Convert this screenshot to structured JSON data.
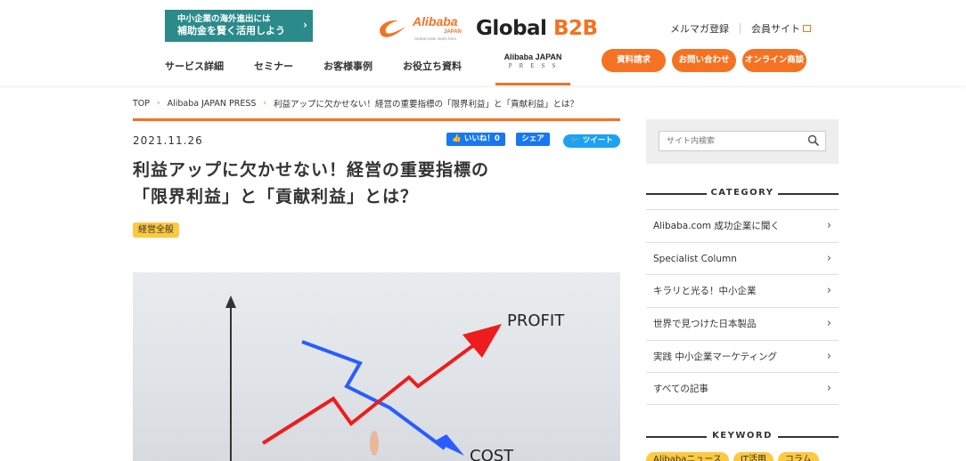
{
  "header": {
    "promo_line1": "中小企業の海外進出には",
    "promo_line2": "補助金を賢く活用しよう",
    "logo_alibaba": "Alibaba",
    "logo_japan": "JAPAN",
    "logo_tagline": "Global trade starts here.",
    "logo_global": "Global",
    "logo_b2b": "B2B",
    "top_links": [
      "メルマガ登録",
      "会員サイト"
    ],
    "nav": [
      "サービス詳細",
      "セミナー",
      "お客様事例",
      "お役立ち資料"
    ],
    "press_line1": "Alibaba JAPAN",
    "press_line2": "PRESS",
    "buttons": [
      "資料請求",
      "お問い合わせ",
      "オンライン商談"
    ]
  },
  "breadcrumb": [
    "TOP",
    "Alibaba JAPAN PRESS",
    "利益アップに欠かせない！経営の重要指標の「限界利益」と「貢献利益」とは？"
  ],
  "article": {
    "date": "2021.11.26",
    "fb_like": "いいね！0",
    "fb_share": "シェア",
    "tweet": "ツイート",
    "title_line1": "利益アップに欠かせない！経営の重要指標の",
    "title_line2": "「限界利益」と「貢献利益」とは？",
    "tag": "経営全般",
    "image_text_profit": "PROFIT",
    "image_text_cost": "COST"
  },
  "sidebar": {
    "search_placeholder": "サイト内検索",
    "category_heading": "CATEGORY",
    "categories": [
      "Alibaba.com 成功企業に聞く",
      "Specialist Column",
      "キラリと光る！中小企業",
      "世界で見つけた日本製品",
      "実践 中小企業マーケティング",
      "すべての記事"
    ],
    "keyword_heading": "KEYWORD",
    "keywords": [
      "Alibabaニュース",
      "IT活用",
      "コラム"
    ]
  },
  "colors": {
    "accent": "#f57222",
    "promo_bg": "#2b8a8a",
    "tag_bg": "#fdc940",
    "facebook": "#1877f2",
    "twitter": "#1da1f2"
  }
}
